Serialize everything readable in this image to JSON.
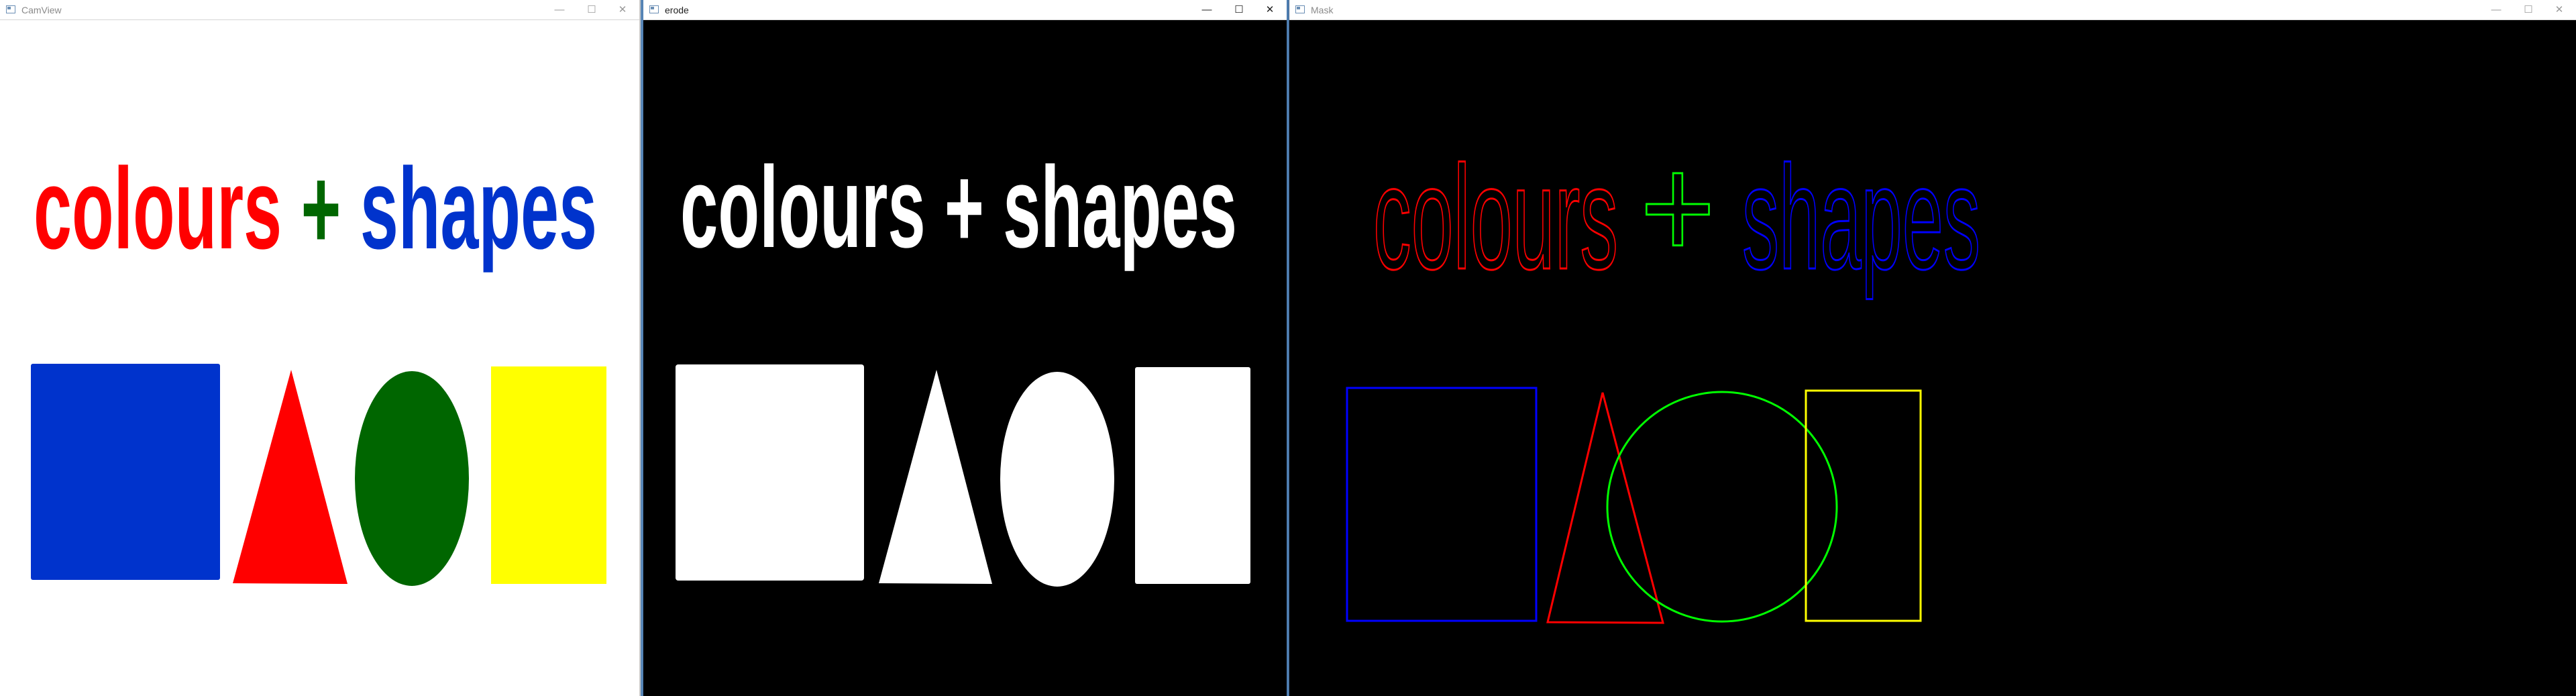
{
  "windows": [
    {
      "title": "CamView",
      "headline": {
        "word1": "colours",
        "plus": "+",
        "word2": "shapes"
      },
      "colors": {
        "word1": "#ff0000",
        "plus": "#006600",
        "word2": "#0033cc",
        "square": "#0033cc",
        "triangle": "#ff0000",
        "ellipse": "#006600",
        "rect": "#ffff00",
        "background": "#ffffff"
      },
      "controls": {
        "minimize": "—",
        "maximize": "☐",
        "close": "✕"
      }
    },
    {
      "title": "erode",
      "headline": {
        "word1": "colours",
        "plus": "+",
        "word2": "shapes"
      },
      "colors": {
        "fill": "#ffffff",
        "background": "#000000"
      },
      "controls": {
        "minimize": "—",
        "maximize": "☐",
        "close": "✕"
      }
    },
    {
      "title": "Mask",
      "headline": {
        "word1": "colours",
        "plus": "+",
        "word2": "shapes"
      },
      "colors": {
        "word1": "#ff0000",
        "plus": "#00ff00",
        "word2": "#0000ff",
        "rect_outline": "#0000ff",
        "triangle_outline": "#ff0000",
        "circle_outline": "#00ff00",
        "square_outline": "#ffff00",
        "background": "#000000"
      },
      "controls": {
        "minimize": "—",
        "maximize": "☐",
        "close": "✕"
      }
    }
  ]
}
